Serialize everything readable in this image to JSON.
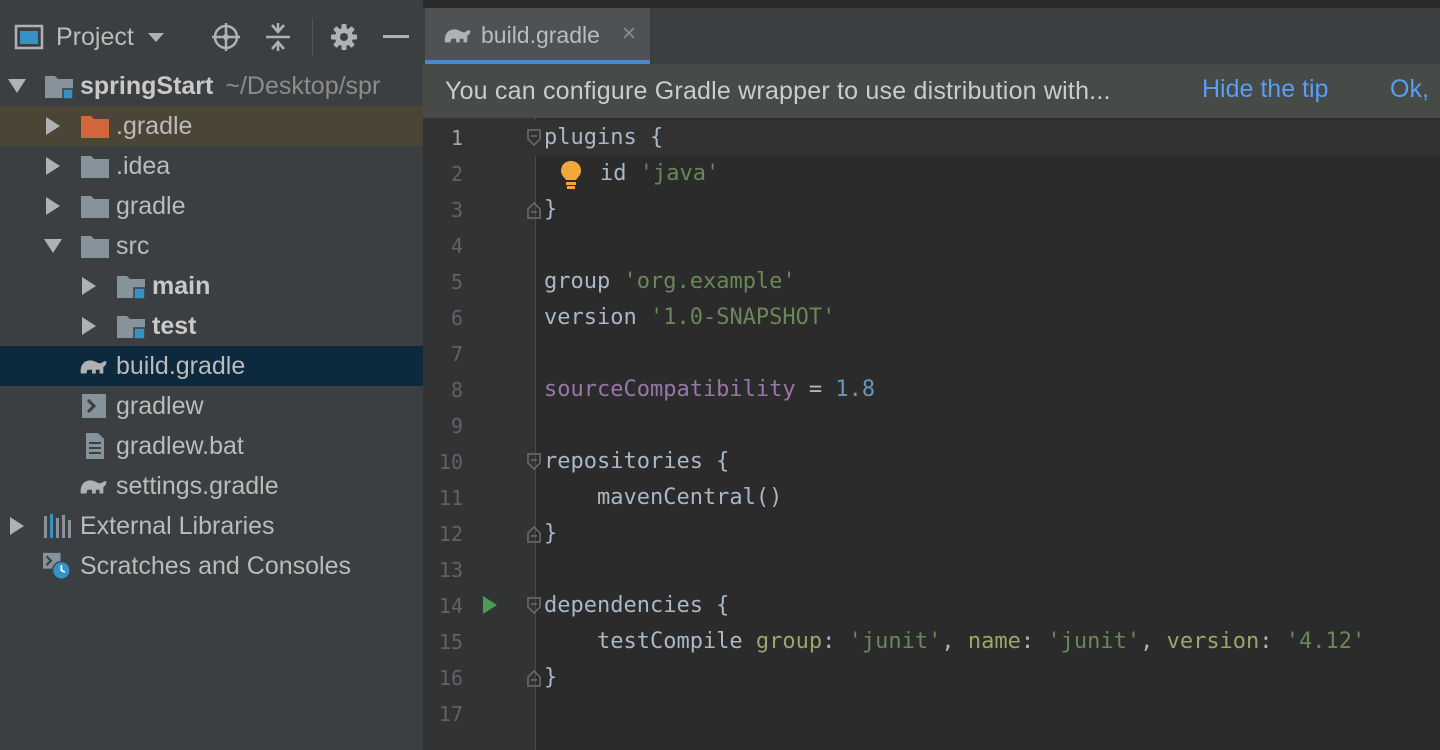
{
  "project_panel": {
    "title": "Project",
    "icons": [
      "project-window-icon",
      "dropdown-caret-icon",
      "locate-icon",
      "collapse-all-icon",
      "gear-icon",
      "minimize-icon"
    ]
  },
  "tree": {
    "root": {
      "name": "springStart",
      "path": "~/Desktop/spr"
    },
    "items": [
      {
        "label": ".gradle",
        "icon": "folder-excluded-icon"
      },
      {
        "label": ".idea",
        "icon": "folder-icon"
      },
      {
        "label": "gradle",
        "icon": "folder-icon"
      },
      {
        "label": "src",
        "icon": "folder-icon"
      },
      {
        "label": "main",
        "icon": "source-folder-icon"
      },
      {
        "label": "test",
        "icon": "source-folder-icon"
      },
      {
        "label": "build.gradle",
        "icon": "gradle-elephant-icon"
      },
      {
        "label": "gradlew",
        "icon": "shell-script-icon"
      },
      {
        "label": "gradlew.bat",
        "icon": "text-file-icon"
      },
      {
        "label": "settings.gradle",
        "icon": "gradle-elephant-icon"
      },
      {
        "label": "External Libraries",
        "icon": "libraries-icon"
      },
      {
        "label": "Scratches and Consoles",
        "icon": "scratches-icon"
      }
    ]
  },
  "editor": {
    "tab": {
      "label": "build.gradle",
      "close": "×"
    },
    "tip": {
      "text": "You can configure Gradle wrapper to use distribution with...",
      "hide_link": "Hide the tip",
      "ok_link": "Ok,"
    },
    "line_numbers": [
      "1",
      "2",
      "3",
      "4",
      "5",
      "6",
      "7",
      "8",
      "9",
      "10",
      "11",
      "12",
      "13",
      "14",
      "15",
      "16",
      "17"
    ],
    "code": {
      "l1": "plugins {",
      "l2_kw": "id ",
      "l2_str": "'java'",
      "l3": "}",
      "l5_kw": "group ",
      "l5_str": "'org.example'",
      "l6_kw": "version ",
      "l6_str": "'1.0-SNAPSHOT'",
      "l8_prop": "sourceCompatibility",
      "l8_eq": " = ",
      "l8_num": "1.8",
      "l10": "repositories {",
      "l11": "    mavenCentral()",
      "l12": "}",
      "l14": "dependencies {",
      "l15_a": "    testCompile ",
      "l15_b": "group",
      "l15_c": ": ",
      "l15_d": "'junit'",
      "l15_e": ", ",
      "l15_f": "name",
      "l15_g": ": ",
      "l15_h": "'junit'",
      "l15_i": ", ",
      "l15_j": "version",
      "l15_k": ": ",
      "l15_l": "'4.12'",
      "l16": "}"
    }
  },
  "colors": {
    "accent": "#4a88c7",
    "link": "#589df6",
    "string": "#6a8759",
    "property": "#9876aa",
    "number": "#6897bb",
    "run": "#499c54",
    "bulb": "#f2a73b"
  }
}
